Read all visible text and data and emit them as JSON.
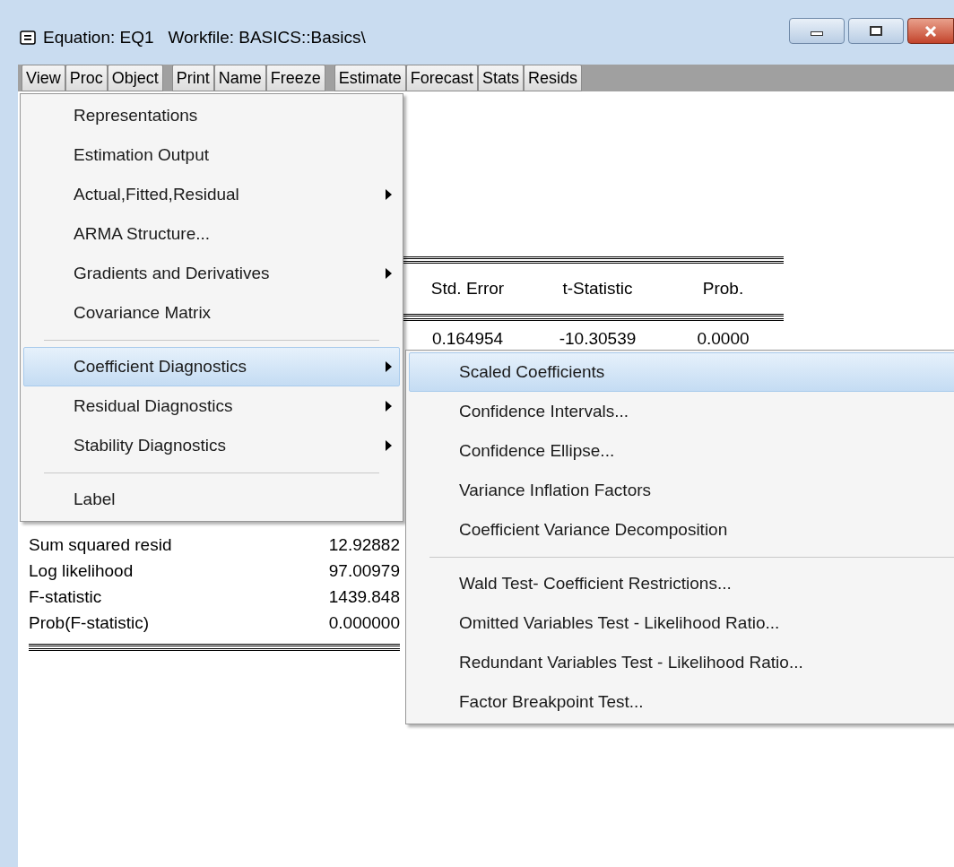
{
  "window": {
    "title": "Equation: EQ1   Workfile: BASICS::Basics\\"
  },
  "toolbar": [
    [
      "View",
      "Proc",
      "Object"
    ],
    [
      "Print",
      "Name",
      "Freeze"
    ],
    [
      "Estimate",
      "Forecast",
      "Stats",
      "Resids"
    ]
  ],
  "results": {
    "columns": [
      "Std. Error",
      "t-Statistic",
      "Prob."
    ],
    "rows": [
      [
        "0.164954",
        "-10.30539",
        "0.0000"
      ]
    ]
  },
  "stats": [
    {
      "label": "Sum squared resid",
      "value": "12.92882"
    },
    {
      "label": "Log likelihood",
      "value": "97.00979"
    },
    {
      "label": "F-statistic",
      "value": "1439.848"
    },
    {
      "label": "Prob(F-statistic)",
      "value": "0.000000"
    }
  ],
  "view_menu": [
    {
      "kind": "item",
      "label": "Representations",
      "submenu": false,
      "selected": false
    },
    {
      "kind": "item",
      "label": "Estimation Output",
      "submenu": false,
      "selected": false
    },
    {
      "kind": "item",
      "label": "Actual,Fitted,Residual",
      "submenu": true,
      "selected": false
    },
    {
      "kind": "item",
      "label": "ARMA Structure...",
      "submenu": false,
      "selected": false
    },
    {
      "kind": "item",
      "label": "Gradients and Derivatives",
      "submenu": true,
      "selected": false
    },
    {
      "kind": "item",
      "label": "Covariance Matrix",
      "submenu": false,
      "selected": false
    },
    {
      "kind": "separator"
    },
    {
      "kind": "item",
      "label": "Coefficient Diagnostics",
      "submenu": true,
      "selected": true
    },
    {
      "kind": "item",
      "label": "Residual Diagnostics",
      "submenu": true,
      "selected": false
    },
    {
      "kind": "item",
      "label": "Stability Diagnostics",
      "submenu": true,
      "selected": false
    },
    {
      "kind": "separator"
    },
    {
      "kind": "item",
      "label": "Label",
      "submenu": false,
      "selected": false
    }
  ],
  "submenu": [
    {
      "kind": "item",
      "label": "Scaled Coefficients",
      "selected": true
    },
    {
      "kind": "item",
      "label": "Confidence Intervals...",
      "selected": false
    },
    {
      "kind": "item",
      "label": "Confidence Ellipse...",
      "selected": false
    },
    {
      "kind": "item",
      "label": "Variance Inflation Factors",
      "selected": false
    },
    {
      "kind": "item",
      "label": "Coefficient Variance Decomposition",
      "selected": false
    },
    {
      "kind": "separator"
    },
    {
      "kind": "item",
      "label": "Wald Test- Coefficient Restrictions...",
      "selected": false
    },
    {
      "kind": "item",
      "label": "Omitted Variables Test - Likelihood Ratio...",
      "selected": false
    },
    {
      "kind": "item",
      "label": "Redundant Variables Test - Likelihood Ratio...",
      "selected": false
    },
    {
      "kind": "item",
      "label": "Factor Breakpoint Test...",
      "selected": false
    }
  ]
}
